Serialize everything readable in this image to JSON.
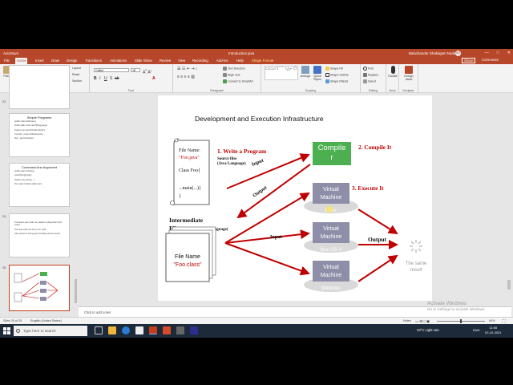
{
  "window": {
    "autosave": "AutoSave",
    "title": "Introduction java",
    "user_name": "Balachandar Shaktigam Nadar",
    "user_initials": "BS",
    "minimize": "—",
    "restore": "□",
    "close": "✕"
  },
  "tabs": [
    "File",
    "Home",
    "Insert",
    "Draw",
    "Design",
    "Transitions",
    "Animations",
    "Slide Show",
    "Review",
    "View",
    "Recording",
    "Add-ins",
    "Help",
    "Shape Format"
  ],
  "share_label": "Share",
  "comments_label": "Comments",
  "ribbon": {
    "clipboard": {
      "label": "Clipboard",
      "paste": "Paste",
      "cut": "Cut",
      "copy": "Copy",
      "format_painter": "Format Painter"
    },
    "slides": {
      "label": "Slides",
      "new_slide": "New Slide",
      "reuse_slides": "Reuse Slides",
      "layout": "Layout",
      "reset": "Reset",
      "section": "Section"
    },
    "font": {
      "label": "Font",
      "font_name": "Calibri",
      "font_size": "18"
    },
    "paragraph": {
      "label": "Paragraph",
      "text_direction": "Text Direction",
      "align_text": "Align Text",
      "convert_smartart": "Convert to SmartArt"
    },
    "drawing": {
      "label": "Drawing",
      "arrange": "Arrange",
      "quick_styles": "Quick Styles",
      "shape_fill": "Shape Fill",
      "shape_outline": "Shape Outline",
      "shape_effects": "Shape Effects"
    },
    "editing": {
      "label": "Editing",
      "find": "Find",
      "replace": "Replace",
      "select": "Select"
    },
    "voice": {
      "label": "Voice",
      "dictate": "Dictate"
    },
    "designer": {
      "label": "Designer",
      "design_ideas": "Design Ideas"
    }
  },
  "thumbnails": [
    {
      "num": "22",
      "title": "",
      "lines": []
    },
    {
      "num": "",
      "title": "Simple Programs",
      "lines": [
        "public class HelloJava {",
        "public static void main(String[] args)",
        "System.out.println(\"Hello World\");",
        "}",
        "Compile : javac HelloJava.java",
        "Run : java HelloJava"
      ]
    },
    {
      "num": "",
      "title": "Command line Argument",
      "lines": [
        "public class CmdArg {",
        "main(String[] args)",
        "System.out.println(...)",
        "Run: java CmdArg Hello Java"
      ]
    },
    {
      "num": "24",
      "title": "",
      "lines": [
        "Translates java code into platform independent byte codes",
        "The byte code can be run on JVM",
        "Also performs strong type checking across source"
      ]
    },
    {
      "num": "25",
      "title": "",
      "lines": []
    }
  ],
  "slide": {
    "title": "Development and Execution Infrastructure",
    "step1": "1. Write a Program",
    "source_files": "Source files",
    "java_language": "(Java Language)",
    "file_name_label": "File Name:",
    "file_name_value": "\"Foo.java\"",
    "code1": "Class Foo{",
    "code2": "...main(...){",
    "code3": "}",
    "input_top": "Input",
    "output_left": "Output",
    "compiler": "Compile",
    "compiler2": "r",
    "step2": "2. Compile It",
    "step3": "3. Execute It",
    "vm": "Virtual",
    "vm2": "Machine",
    "linux": "Linux",
    "macos": "Mac OS X",
    "windows": "Windows",
    "intermediate": "Intermediate",
    "files": "Files",
    "intermediate_language": "(Intermediate Language)",
    "file_name2": "File Name",
    "foo_class": "\"Foo.class\"",
    "input_mid": "Input",
    "output_right": "Output",
    "same_result": "The same",
    "result": "result"
  },
  "notes_placeholder": "Click to add notes",
  "status": {
    "slide_of": "Slide 25 of 25",
    "language": "English (United States)",
    "notes": "Notes",
    "zoom": "64%"
  },
  "watermark": {
    "line1": "Activate Windows",
    "line2": "Go to Settings to activate Windows."
  },
  "taskbar": {
    "search_placeholder": "Type here to search",
    "weather": "33°C  Light rain",
    "lang": "ENG",
    "time": "11:55",
    "date": "02-10-2021"
  },
  "colors": {
    "accent": "#b7472a",
    "arrow": "#c00000",
    "compiler_green": "#4caf50",
    "vm_gray": "#8e8ea9"
  }
}
